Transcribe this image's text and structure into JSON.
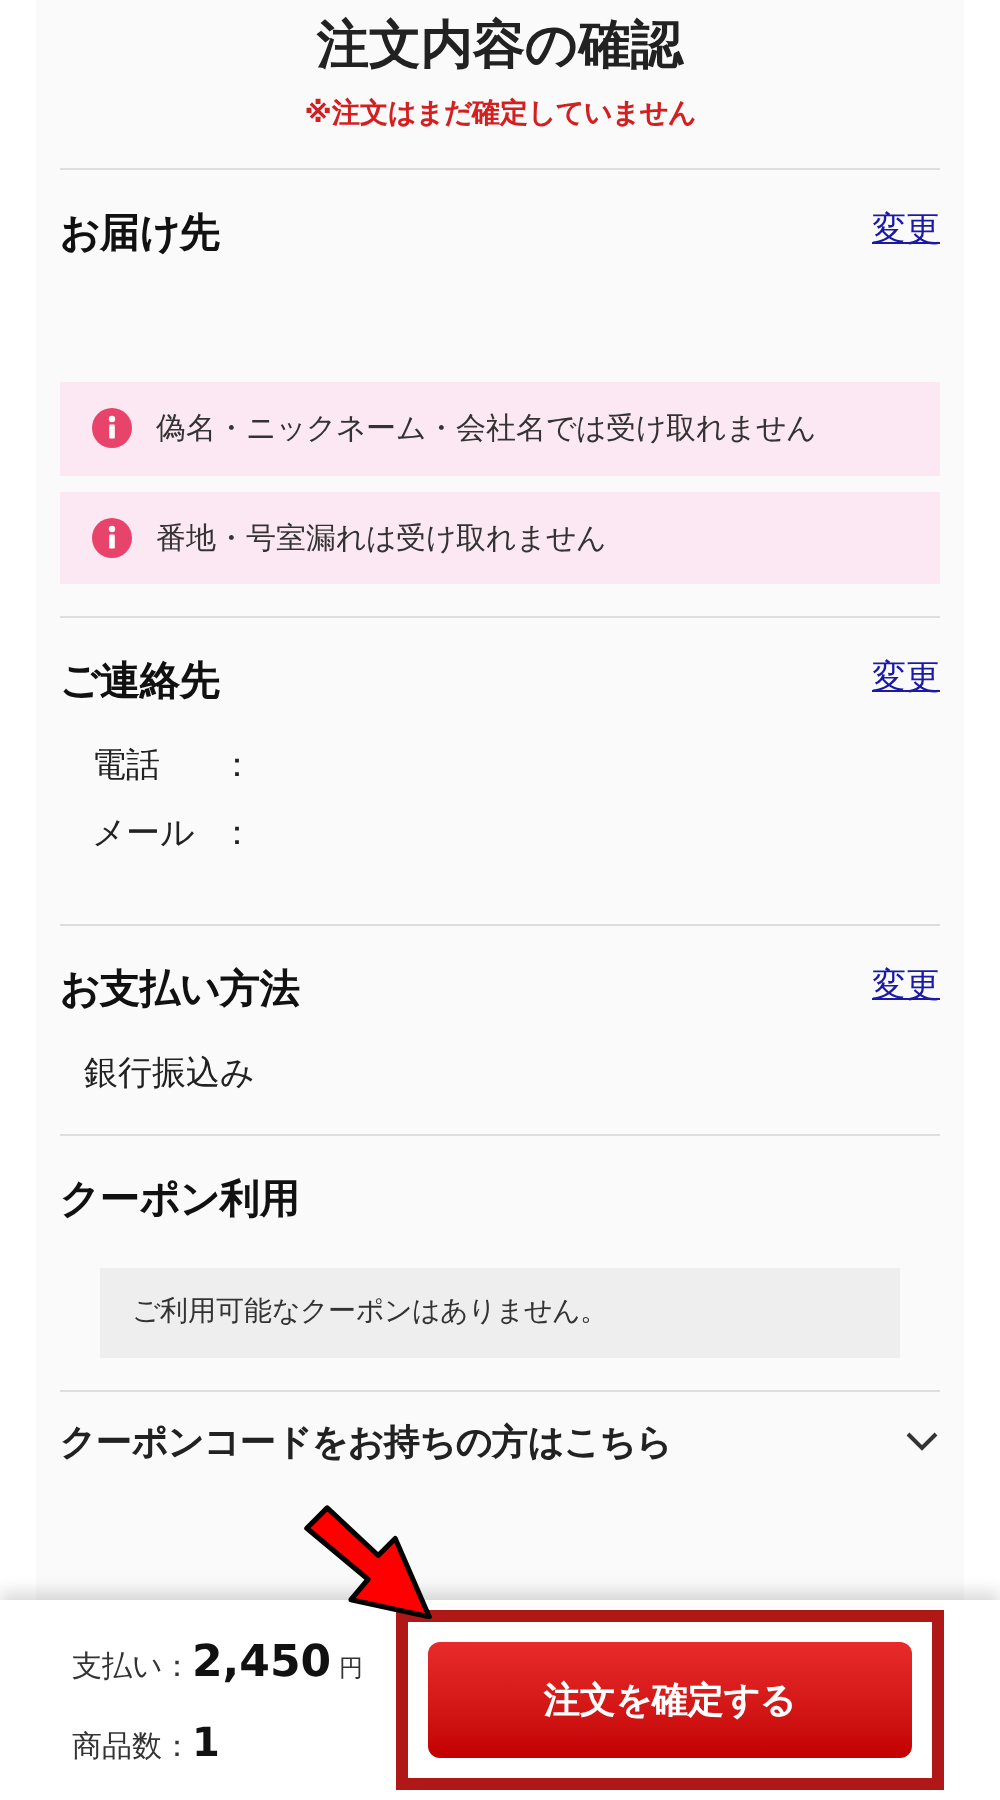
{
  "header": {
    "title": "注文内容の確認",
    "notice": "※注文はまだ確定していません"
  },
  "sections": [
    {
      "kind": "address",
      "title": "お届け先",
      "change_link": "変更",
      "alerts": [
        "偽名・ニックネーム・会社名では受け取れません",
        "番地・号室漏れは受け取れません"
      ]
    },
    {
      "kind": "contact",
      "title": "ご連絡先",
      "change_link": "変更",
      "fields": [
        {
          "label": "電話",
          "colon": "："
        },
        {
          "label": "メール",
          "colon": "："
        }
      ]
    },
    {
      "kind": "payment",
      "title": "お支払い方法",
      "change_link": "変更",
      "value": "銀行振込み"
    },
    {
      "kind": "coupon",
      "title": "クーポン利用",
      "message": "ご利用可能なクーポンはありません。"
    }
  ],
  "coupon_code": {
    "label": "クーポンコードをお持ちの方はこちら",
    "expanded": false
  },
  "footer": {
    "payment_label": "支払い：",
    "amount": "2,450",
    "currency": "円",
    "items_label": "商品数：",
    "items": "1",
    "confirm_button": "注文を確定する"
  }
}
